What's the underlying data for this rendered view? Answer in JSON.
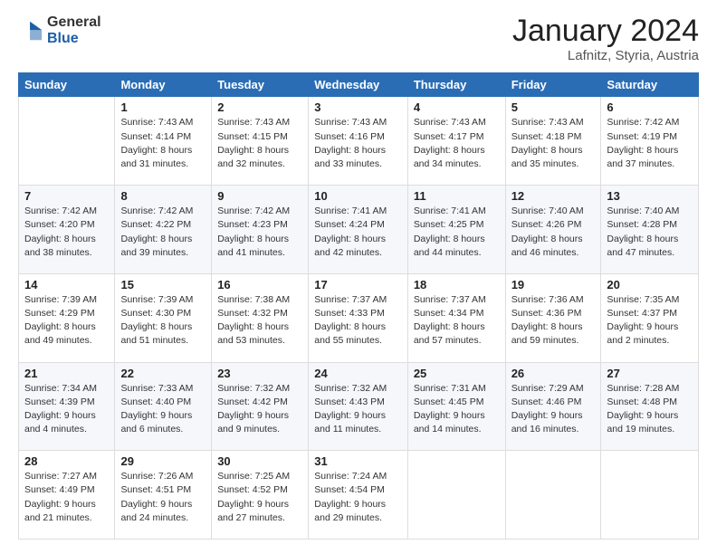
{
  "logo": {
    "general": "General",
    "blue": "Blue"
  },
  "title": "January 2024",
  "subtitle": "Lafnitz, Styria, Austria",
  "headers": [
    "Sunday",
    "Monday",
    "Tuesday",
    "Wednesday",
    "Thursday",
    "Friday",
    "Saturday"
  ],
  "weeks": [
    [
      {
        "day": "",
        "info": ""
      },
      {
        "day": "1",
        "info": "Sunrise: 7:43 AM\nSunset: 4:14 PM\nDaylight: 8 hours\nand 31 minutes."
      },
      {
        "day": "2",
        "info": "Sunrise: 7:43 AM\nSunset: 4:15 PM\nDaylight: 8 hours\nand 32 minutes."
      },
      {
        "day": "3",
        "info": "Sunrise: 7:43 AM\nSunset: 4:16 PM\nDaylight: 8 hours\nand 33 minutes."
      },
      {
        "day": "4",
        "info": "Sunrise: 7:43 AM\nSunset: 4:17 PM\nDaylight: 8 hours\nand 34 minutes."
      },
      {
        "day": "5",
        "info": "Sunrise: 7:43 AM\nSunset: 4:18 PM\nDaylight: 8 hours\nand 35 minutes."
      },
      {
        "day": "6",
        "info": "Sunrise: 7:42 AM\nSunset: 4:19 PM\nDaylight: 8 hours\nand 37 minutes."
      }
    ],
    [
      {
        "day": "7",
        "info": "Sunrise: 7:42 AM\nSunset: 4:20 PM\nDaylight: 8 hours\nand 38 minutes."
      },
      {
        "day": "8",
        "info": "Sunrise: 7:42 AM\nSunset: 4:22 PM\nDaylight: 8 hours\nand 39 minutes."
      },
      {
        "day": "9",
        "info": "Sunrise: 7:42 AM\nSunset: 4:23 PM\nDaylight: 8 hours\nand 41 minutes."
      },
      {
        "day": "10",
        "info": "Sunrise: 7:41 AM\nSunset: 4:24 PM\nDaylight: 8 hours\nand 42 minutes."
      },
      {
        "day": "11",
        "info": "Sunrise: 7:41 AM\nSunset: 4:25 PM\nDaylight: 8 hours\nand 44 minutes."
      },
      {
        "day": "12",
        "info": "Sunrise: 7:40 AM\nSunset: 4:26 PM\nDaylight: 8 hours\nand 46 minutes."
      },
      {
        "day": "13",
        "info": "Sunrise: 7:40 AM\nSunset: 4:28 PM\nDaylight: 8 hours\nand 47 minutes."
      }
    ],
    [
      {
        "day": "14",
        "info": "Sunrise: 7:39 AM\nSunset: 4:29 PM\nDaylight: 8 hours\nand 49 minutes."
      },
      {
        "day": "15",
        "info": "Sunrise: 7:39 AM\nSunset: 4:30 PM\nDaylight: 8 hours\nand 51 minutes."
      },
      {
        "day": "16",
        "info": "Sunrise: 7:38 AM\nSunset: 4:32 PM\nDaylight: 8 hours\nand 53 minutes."
      },
      {
        "day": "17",
        "info": "Sunrise: 7:37 AM\nSunset: 4:33 PM\nDaylight: 8 hours\nand 55 minutes."
      },
      {
        "day": "18",
        "info": "Sunrise: 7:37 AM\nSunset: 4:34 PM\nDaylight: 8 hours\nand 57 minutes."
      },
      {
        "day": "19",
        "info": "Sunrise: 7:36 AM\nSunset: 4:36 PM\nDaylight: 8 hours\nand 59 minutes."
      },
      {
        "day": "20",
        "info": "Sunrise: 7:35 AM\nSunset: 4:37 PM\nDaylight: 9 hours\nand 2 minutes."
      }
    ],
    [
      {
        "day": "21",
        "info": "Sunrise: 7:34 AM\nSunset: 4:39 PM\nDaylight: 9 hours\nand 4 minutes."
      },
      {
        "day": "22",
        "info": "Sunrise: 7:33 AM\nSunset: 4:40 PM\nDaylight: 9 hours\nand 6 minutes."
      },
      {
        "day": "23",
        "info": "Sunrise: 7:32 AM\nSunset: 4:42 PM\nDaylight: 9 hours\nand 9 minutes."
      },
      {
        "day": "24",
        "info": "Sunrise: 7:32 AM\nSunset: 4:43 PM\nDaylight: 9 hours\nand 11 minutes."
      },
      {
        "day": "25",
        "info": "Sunrise: 7:31 AM\nSunset: 4:45 PM\nDaylight: 9 hours\nand 14 minutes."
      },
      {
        "day": "26",
        "info": "Sunrise: 7:29 AM\nSunset: 4:46 PM\nDaylight: 9 hours\nand 16 minutes."
      },
      {
        "day": "27",
        "info": "Sunrise: 7:28 AM\nSunset: 4:48 PM\nDaylight: 9 hours\nand 19 minutes."
      }
    ],
    [
      {
        "day": "28",
        "info": "Sunrise: 7:27 AM\nSunset: 4:49 PM\nDaylight: 9 hours\nand 21 minutes."
      },
      {
        "day": "29",
        "info": "Sunrise: 7:26 AM\nSunset: 4:51 PM\nDaylight: 9 hours\nand 24 minutes."
      },
      {
        "day": "30",
        "info": "Sunrise: 7:25 AM\nSunset: 4:52 PM\nDaylight: 9 hours\nand 27 minutes."
      },
      {
        "day": "31",
        "info": "Sunrise: 7:24 AM\nSunset: 4:54 PM\nDaylight: 9 hours\nand 29 minutes."
      },
      {
        "day": "",
        "info": ""
      },
      {
        "day": "",
        "info": ""
      },
      {
        "day": "",
        "info": ""
      }
    ]
  ]
}
